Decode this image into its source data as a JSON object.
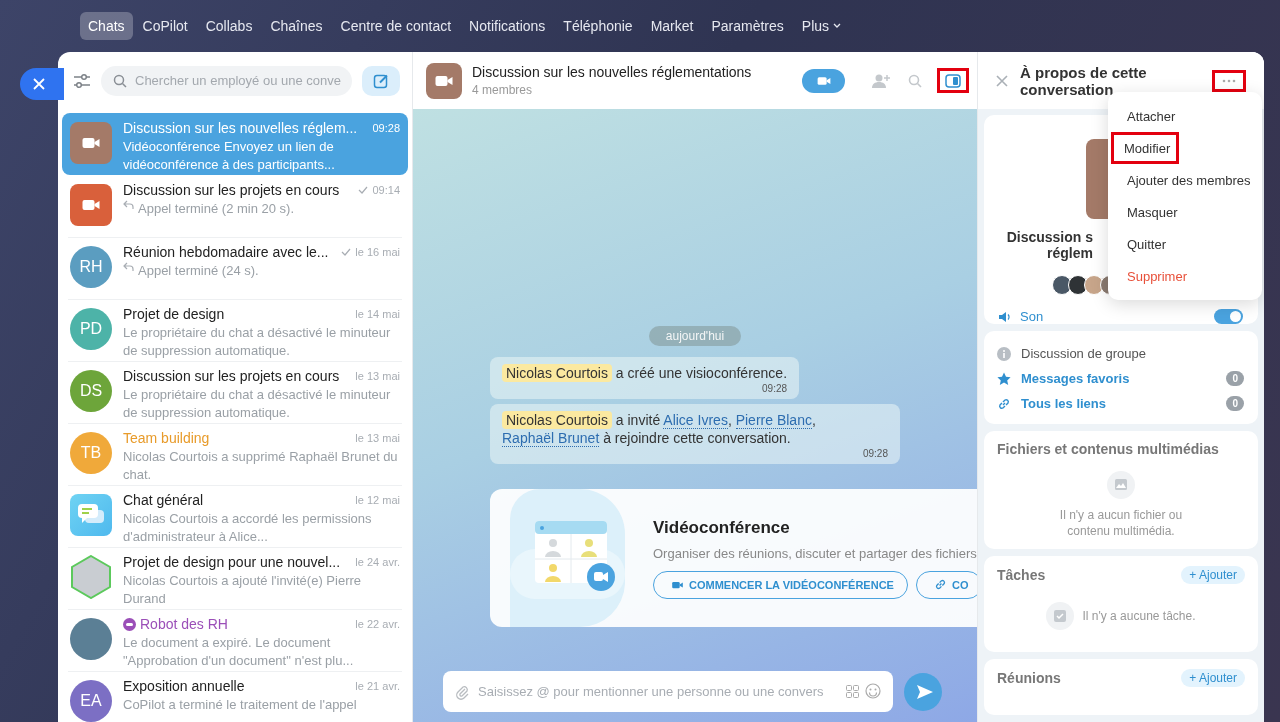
{
  "nav": {
    "items": [
      {
        "label": "Chats",
        "selected": true,
        "dropdown": false
      },
      {
        "label": "CoPilot",
        "selected": false,
        "dropdown": false
      },
      {
        "label": "Collabs",
        "selected": false,
        "dropdown": false
      },
      {
        "label": "Chaînes",
        "selected": false,
        "dropdown": false
      },
      {
        "label": "Centre de contact",
        "selected": false,
        "dropdown": false
      },
      {
        "label": "Notifications",
        "selected": false,
        "dropdown": false
      },
      {
        "label": "Téléphonie",
        "selected": false,
        "dropdown": false
      },
      {
        "label": "Market",
        "selected": false,
        "dropdown": false
      },
      {
        "label": "Paramètres",
        "selected": false,
        "dropdown": false
      },
      {
        "label": "Plus",
        "selected": false,
        "dropdown": true
      }
    ]
  },
  "sidebar": {
    "search": {
      "placeholder": "Chercher un employé ou une conve"
    },
    "chats": [
      {
        "kind": "regular",
        "title": "Discussion sur les nouvelles réglem...",
        "time": "09:28",
        "preview": "Vidéoconférence Envoyez un lien de vidéoconférence à des participants...",
        "avatar": {
          "kind": "video",
          "color": "#a47a68"
        },
        "selected": true,
        "read": false,
        "reply": false
      },
      {
        "kind": "regular",
        "title": "Discussion sur les projets en cours",
        "time": "09:14",
        "preview": "Appel terminé (2 min 20 s).",
        "avatar": {
          "kind": "video",
          "color": "#d9603b"
        },
        "selected": false,
        "read": true,
        "reply": true
      },
      {
        "kind": "regular",
        "title": "Réunion hebdomadaire avec le...",
        "time": "le 16 mai",
        "preview": "Appel terminé (24 s).",
        "avatar": {
          "kind": "initials",
          "initials": "RH",
          "color": "#5b9dc0"
        },
        "selected": false,
        "read": true,
        "reply": true
      },
      {
        "kind": "regular",
        "title": "Projet de design",
        "time": "le 14 mai",
        "preview": "Le propriétaire du chat a désactivé le minuteur de suppression automatique.",
        "avatar": {
          "kind": "initials",
          "initials": "PD",
          "color": "#4db3a8"
        },
        "selected": false,
        "read": false,
        "reply": false
      },
      {
        "kind": "regular",
        "title": "Discussion sur les projets en cours",
        "time": "le 13 mai",
        "preview": "Le propriétaire du chat a désactivé le minuteur de suppression automatique.",
        "avatar": {
          "kind": "initials",
          "initials": "DS",
          "color": "#6da53a"
        },
        "selected": false,
        "read": false,
        "reply": false
      },
      {
        "kind": "highlighted",
        "title": "Team building",
        "time": "le 13 mai",
        "preview": "Nicolas Courtois a supprimé Raphaël Brunet du chat.",
        "avatar": {
          "kind": "initials",
          "initials": "TB",
          "color": "#f0a93a"
        },
        "selected": false,
        "read": false,
        "reply": false
      },
      {
        "kind": "regular",
        "title": "Chat général",
        "time": "le 12 mai",
        "preview": "Nicolas Courtois a accordé les permissions d'administrateur à Alice...",
        "avatar": {
          "kind": "chat",
          "color": "#4fb9ee"
        },
        "selected": false,
        "read": false,
        "reply": false
      },
      {
        "kind": "regular",
        "title": "Projet de design pour une nouvel...",
        "time": "le 24 avr.",
        "preview": "Nicolas Courtois a ajouté l'invité(e) Pierre Durand",
        "avatar": {
          "kind": "hexagon",
          "color": "#c9cdd2"
        },
        "selected": false,
        "read": false,
        "reply": false
      },
      {
        "kind": "bot",
        "title": "Robot des RH",
        "time": "le 22 avr.",
        "preview": "Le document a expiré. Le document \"Approbation d'un document\" n'est plu...",
        "avatar": {
          "kind": "photo",
          "color": "#5b7f95"
        },
        "selected": false,
        "read": false,
        "reply": false
      },
      {
        "kind": "regular",
        "title": "Exposition annuelle",
        "time": "le 21 avr.",
        "preview": "CoPilot a terminé le traitement de l'appel",
        "avatar": {
          "kind": "initials",
          "initials": "EA",
          "color": "#7c6fc4"
        },
        "selected": false,
        "read": false,
        "reply": false
      }
    ]
  },
  "chat": {
    "title": "Discussion sur les nouvelles réglementations",
    "subtitle": "4 membres",
    "panel_highlighted": true,
    "date": "aujourd'hui",
    "messages": [
      {
        "time": "09:28",
        "parts": [
          {
            "kind": "mention",
            "text": "Nicolas Courtois"
          },
          {
            "kind": "text",
            "text": " a créé une visioconférence."
          }
        ]
      },
      {
        "time": "09:28",
        "parts": [
          {
            "kind": "mention",
            "text": "Nicolas Courtois"
          },
          {
            "kind": "text",
            "text": " a invité "
          },
          {
            "kind": "link",
            "text": "Alice Ivres"
          },
          {
            "kind": "text",
            "text": ", "
          },
          {
            "kind": "link",
            "text": "Pierre Blanc"
          },
          {
            "kind": "text",
            "text": ", "
          },
          {
            "kind": "link",
            "text": "Raphaël Brunet"
          },
          {
            "kind": "text",
            "text": " à rejoindre cette conversation."
          }
        ]
      }
    ],
    "video_card": {
      "title": "Vidéoconférence",
      "description": "Organiser des réunions, discuter et partager des fichiers",
      "buttons": [
        {
          "label": "COMMENCER LA VIDÉOCONFÉRENCE"
        },
        {
          "label": "CO"
        }
      ]
    },
    "composer": {
      "placeholder": "Saisissez @ pour mentionner une personne ou une convers"
    }
  },
  "details": {
    "title": "À propos de cette conversation",
    "more_highlighted": true,
    "name_lines": [
      "Discussion s",
      "réglem"
    ],
    "members": [
      {
        "color": "#4a5866"
      },
      {
        "color": "#2f3336"
      },
      {
        "color": "#c7a58a"
      },
      {
        "color": "#8a7a70"
      }
    ],
    "sound": {
      "label": "Son",
      "on": true
    },
    "info": "Discussion de groupe",
    "links": [
      {
        "label": "Messages favoris",
        "count": "0"
      },
      {
        "label": "Tous les liens",
        "count": "0"
      }
    ],
    "files": {
      "title": "Fichiers et contenus multimédias",
      "empty": "Il n'y a aucun fichier ou contenu multimédia."
    },
    "tasks": {
      "title": "Tâches",
      "add": "+ Ajouter",
      "empty": "Il n'y a aucune tâche."
    },
    "meetings": {
      "title": "Réunions",
      "add": "+ Ajouter"
    }
  },
  "menu": [
    {
      "label": "Attacher",
      "highlighted": false,
      "danger": false
    },
    {
      "label": "Modifier",
      "highlighted": true,
      "danger": false
    },
    {
      "label": "Ajouter des membres",
      "highlighted": false,
      "danger": false
    },
    {
      "label": "Masquer",
      "highlighted": false,
      "danger": false
    },
    {
      "label": "Quitter",
      "highlighted": false,
      "danger": false
    },
    {
      "label": "Supprimer",
      "highlighted": false,
      "danger": true
    }
  ]
}
